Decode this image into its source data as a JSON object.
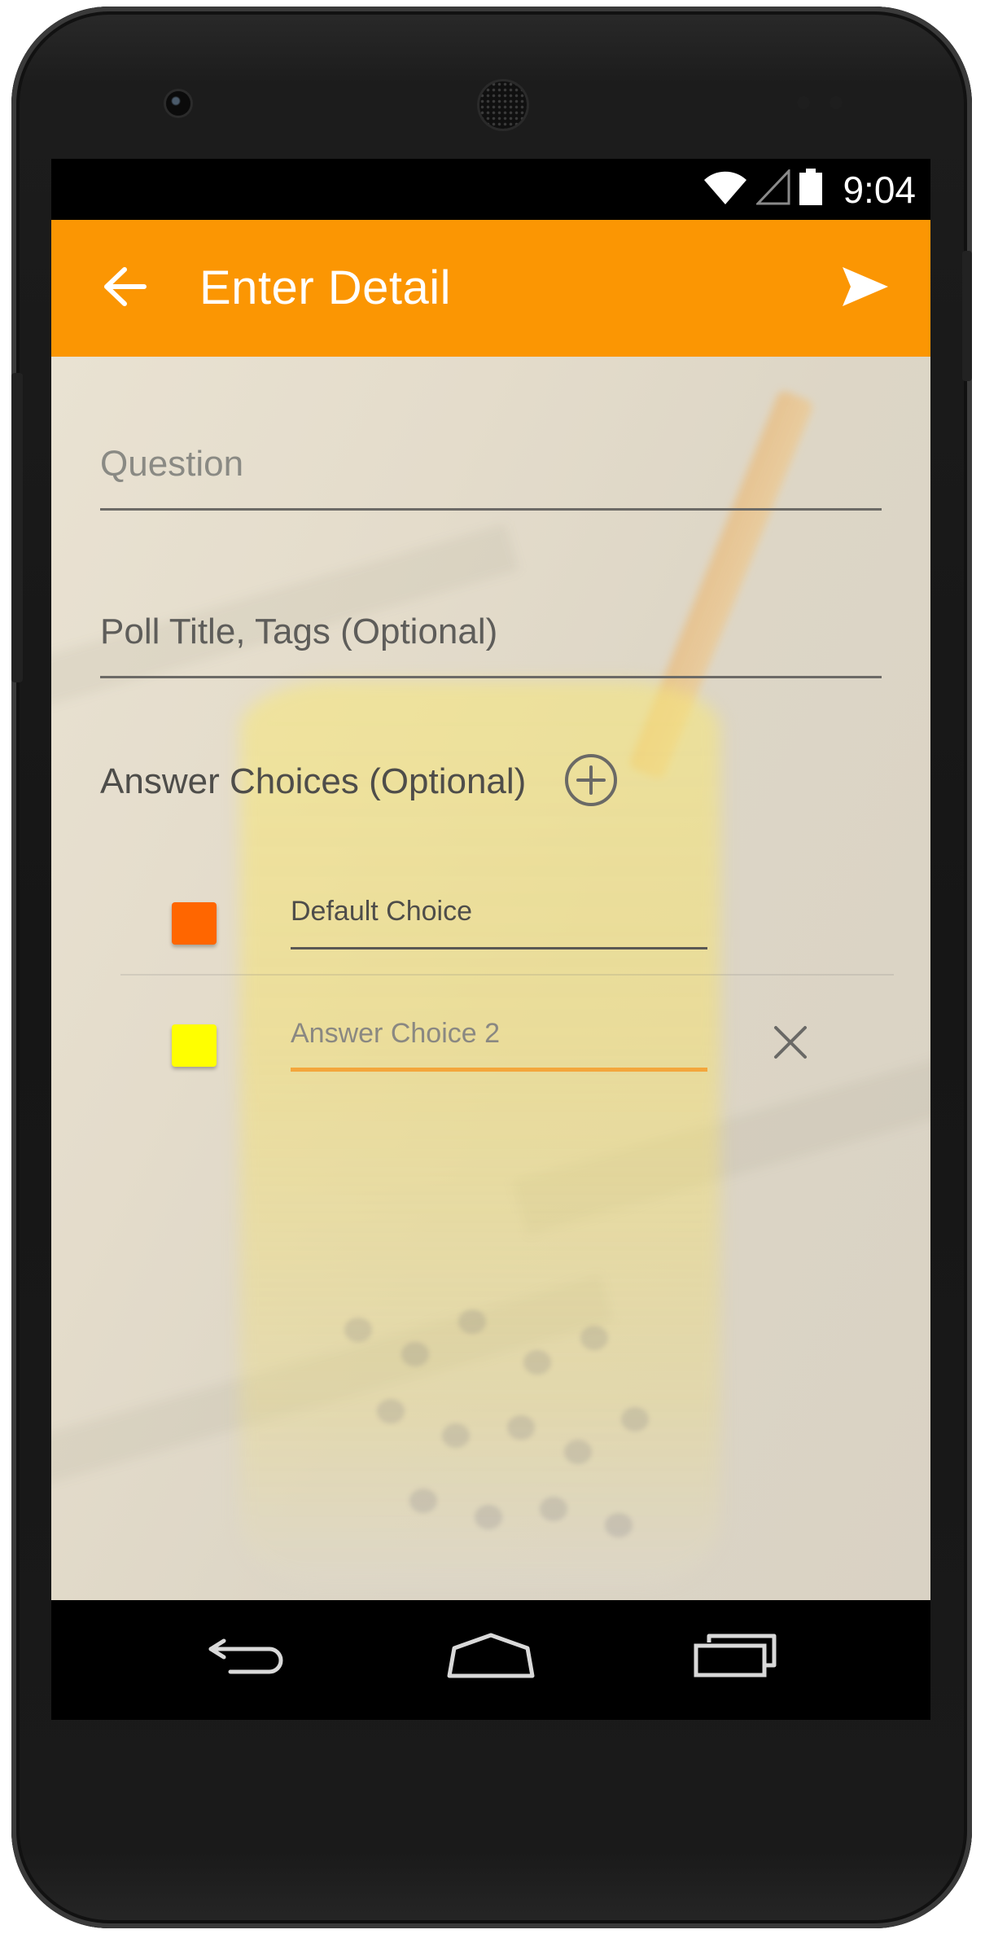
{
  "status_bar": {
    "time": "9:04",
    "icons": [
      "wifi-icon",
      "cell-signal-icon",
      "battery-icon"
    ]
  },
  "app_bar": {
    "title": "Enter Detail",
    "back_icon": "arrow-back-icon",
    "send_icon": "send-icon",
    "color": "#fb9603"
  },
  "form": {
    "question": {
      "value": "",
      "placeholder": "Question"
    },
    "poll_title": {
      "value": "Poll Title, Tags (Optional)",
      "placeholder": ""
    },
    "answers_label": "Answer Choices (Optional)",
    "add_choice_icon": "add-circle-icon",
    "choices": [
      {
        "value": "Default Choice",
        "placeholder": "",
        "color": "#ff6600",
        "removable": false
      },
      {
        "value": "",
        "placeholder": "Answer Choice 2",
        "color": "#ffff00",
        "removable": true,
        "remove_icon": "close-icon"
      }
    ]
  },
  "nav_bar": {
    "back_icon": "nav-back-icon",
    "home_icon": "nav-home-icon",
    "recent_icon": "nav-recent-apps-icon"
  }
}
